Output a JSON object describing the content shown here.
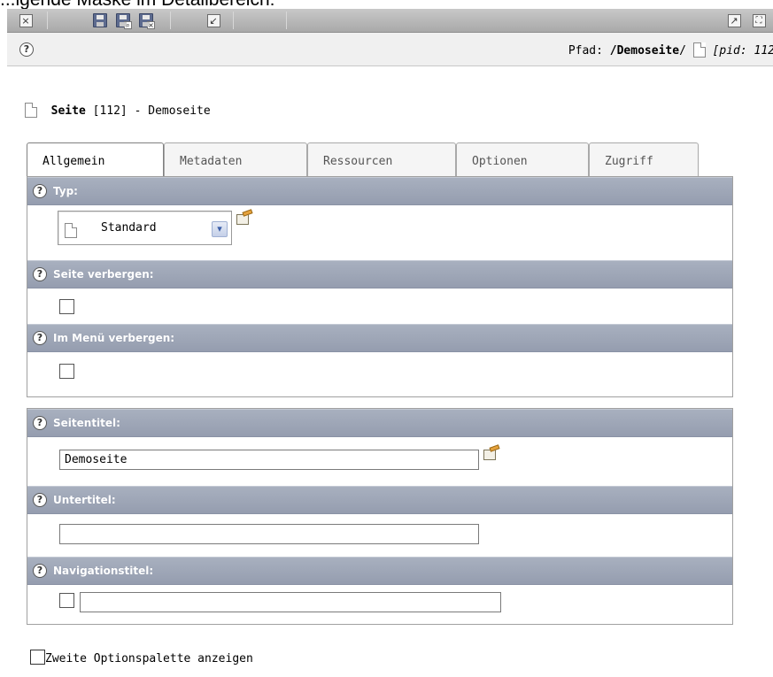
{
  "caption": "...lgende Maske im Detailbereich:",
  "toolbar": {
    "left_buttons": [
      "close-icon",
      "save-icon",
      "save-view-icon",
      "save-close-icon",
      "undo-icon"
    ],
    "right_buttons": [
      "open-new-window-icon",
      "fullscreen-icon"
    ]
  },
  "pathbar": {
    "label": "Pfad: ",
    "path_bold": "/Demoseite",
    "path_sep": "/",
    "pid_text": "[pid: 112"
  },
  "record": {
    "type_label": "Seite",
    "id": "[112]",
    "title_suffix": "- Demoseite"
  },
  "tabs": [
    {
      "label": "Allgemein",
      "active": true
    },
    {
      "label": "Metadaten",
      "active": false
    },
    {
      "label": "Ressourcen",
      "active": false
    },
    {
      "label": "Optionen",
      "active": false
    },
    {
      "label": "Zugriff",
      "active": false
    }
  ],
  "fields": {
    "typ": {
      "label": "Typ:",
      "value": "Standard"
    },
    "seite_verbergen": {
      "label": "Seite verbergen:",
      "checked": false
    },
    "im_menu_verbergen": {
      "label": "Im Menü verbergen:",
      "checked": false
    },
    "seitentitel": {
      "label": "Seitentitel:",
      "value": "Demoseite"
    },
    "untertitel": {
      "label": "Untertitel:",
      "value": ""
    },
    "navigationstitel": {
      "label": "Navigationstitel:",
      "value": "",
      "checked": false
    }
  },
  "bottom": {
    "second_palette_label": "Zweite Optionspalette anzeigen",
    "checked": false
  },
  "colors": {
    "field_header": "#9ea6b6",
    "toolbar": "#b9b9b9",
    "pathbar": "#f0f0f0"
  }
}
